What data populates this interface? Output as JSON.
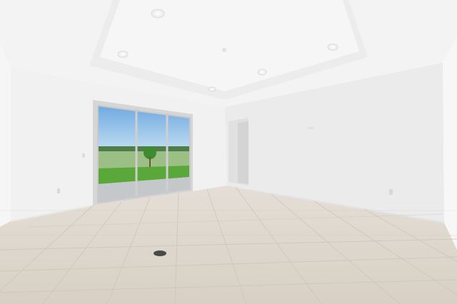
{
  "scene": {
    "subject": "empty-room-interior",
    "palette": {
      "ceiling": "#f4f4f4",
      "tray_ceiling": "#f7f7f7",
      "wall_left": "#f1f1f1",
      "wall_back": "#ededed",
      "wall_right": "#f5f5f5",
      "floor": "#ddd6cc",
      "grout": "#cbc3b8",
      "sky": "#8fbfe8",
      "lawn": "#5aa83a",
      "patio": "#c9cdd0",
      "door_frame": "#d0d0d0"
    },
    "features": [
      "tray-ceiling",
      "recessed-lights",
      "sliding-glass-door",
      "open-doorway",
      "tile-floor",
      "floor-vent",
      "wall-outlets",
      "baseboards"
    ]
  },
  "watermark": {
    "text": ""
  }
}
